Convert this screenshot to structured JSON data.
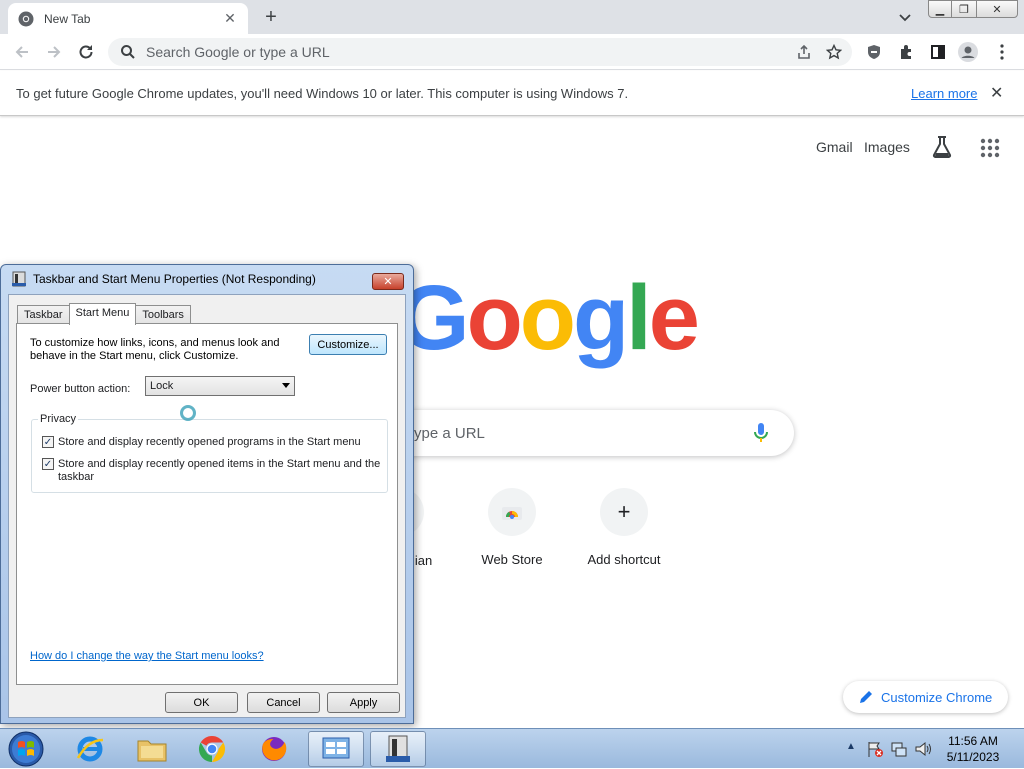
{
  "browser": {
    "tab_title": "New Tab",
    "omnibox_placeholder": "Search Google or type a URL",
    "infobar": {
      "message": "To get future Google Chrome updates, you'll need Windows 10 or later. This computer is using Windows 7.",
      "link": "Learn more"
    }
  },
  "ntp": {
    "top_links": [
      "Gmail",
      "Images"
    ],
    "logo": [
      "G",
      "o",
      "o",
      "g",
      "l",
      "e"
    ],
    "search_placeholder": "ype a URL",
    "partial_shortcut_label": "lian",
    "shortcuts": [
      {
        "label": "Web Store",
        "icon": "web-store-icon"
      },
      {
        "label": "Add shortcut",
        "icon": "plus-icon"
      }
    ],
    "customize_label": "Customize Chrome"
  },
  "dialog": {
    "title": "Taskbar and Start Menu Properties (Not Responding)",
    "tabs": [
      "Taskbar",
      "Start Menu",
      "Toolbars"
    ],
    "active_tab": "Start Menu",
    "description": "To customize how links, icons, and menus look and behave in the Start menu, click Customize.",
    "customize_button": "Customize...",
    "power_label": "Power button action:",
    "power_value": "Lock",
    "privacy_legend": "Privacy",
    "checkbox1": "Store and display recently opened programs in the Start menu",
    "checkbox2": "Store and display recently opened items in the Start menu and the taskbar",
    "help_link": "How do I change the way the Start menu looks?",
    "ok": "OK",
    "cancel": "Cancel",
    "apply": "Apply"
  },
  "taskbar": {
    "time": "11:56 AM",
    "date": "5/11/2023"
  }
}
